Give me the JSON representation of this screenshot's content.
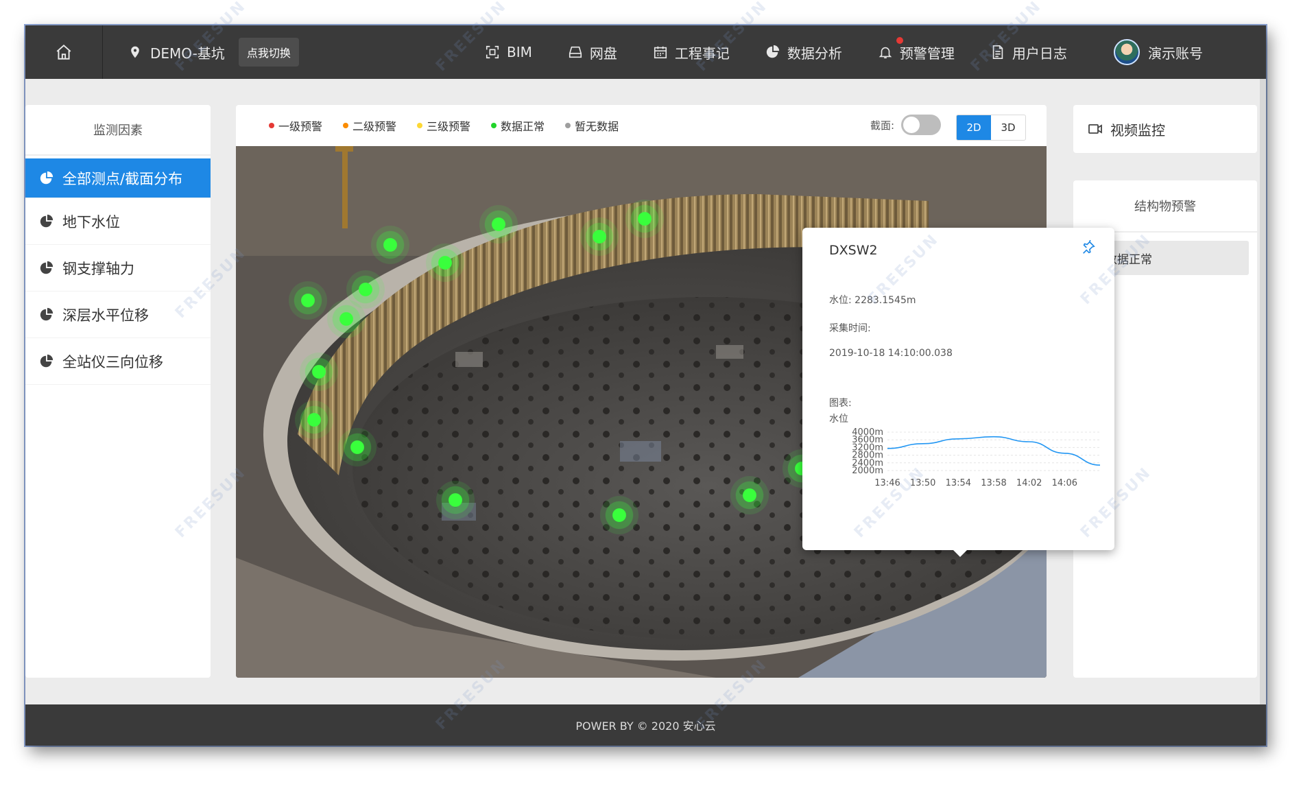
{
  "topbar": {
    "project_name": "DEMO-基坑",
    "switch_label": "点我切换",
    "nav": [
      {
        "label": "BIM",
        "icon": "scan-icon"
      },
      {
        "label": "网盘",
        "icon": "drive-icon"
      },
      {
        "label": "工程事记",
        "icon": "calendar-icon"
      },
      {
        "label": "数据分析",
        "icon": "pie-chart-icon"
      },
      {
        "label": "预警管理",
        "icon": "bell-icon"
      },
      {
        "label": "用户日志",
        "icon": "document-icon"
      }
    ],
    "user_name": "演示账号"
  },
  "left_panel": {
    "title": "监测因素",
    "items": [
      {
        "label": "全部测点/截面分布",
        "active": true
      },
      {
        "label": "地下水位",
        "active": false
      },
      {
        "label": "钢支撑轴力",
        "active": false
      },
      {
        "label": "深层水平位移",
        "active": false
      },
      {
        "label": "全站仪三向位移",
        "active": false
      }
    ]
  },
  "legend": [
    {
      "label": "一级预警",
      "color": "#e53935"
    },
    {
      "label": "二级预警",
      "color": "#fb8c00"
    },
    {
      "label": "三级预警",
      "color": "#fdd835"
    },
    {
      "label": "数据正常",
      "color": "#22d42b"
    },
    {
      "label": "暂无数据",
      "color": "#9e9e9e"
    }
  ],
  "section_label": "截面:",
  "view_modes": [
    "2D",
    "3D"
  ],
  "active_view_mode": "2D",
  "popup": {
    "title": "DXSW2",
    "water_level": "水位: 2283.1545m",
    "collect_time_label": "采集时间:",
    "collect_time": "2019-10-18 14:10:00.038",
    "chart_label": "图表:",
    "series_label": "水位"
  },
  "chart_data": {
    "type": "line",
    "title": "",
    "ylabel": "",
    "xlabel": "",
    "y_ticks": [
      "4000m",
      "3600m",
      "3200m",
      "2800m",
      "2400m",
      "2000m"
    ],
    "ylim": [
      2000,
      4000
    ],
    "x_ticks": [
      "13:46",
      "13:50",
      "13:54",
      "13:58",
      "14:02",
      "14:06"
    ],
    "x": [
      "13:46",
      "13:50",
      "13:54",
      "13:58",
      "14:02",
      "14:06",
      "14:10"
    ],
    "series": [
      {
        "values": [
          3150,
          3400,
          3650,
          3760,
          3500,
          2900,
          2283
        ]
      }
    ]
  },
  "right_panel": {
    "video_label": "视频监控",
    "struct_title": "结构物预警",
    "struct_items": [
      {
        "label": "数据正常",
        "color": "#22d42b"
      }
    ]
  },
  "footer": "POWER BY © 2020 安心云"
}
